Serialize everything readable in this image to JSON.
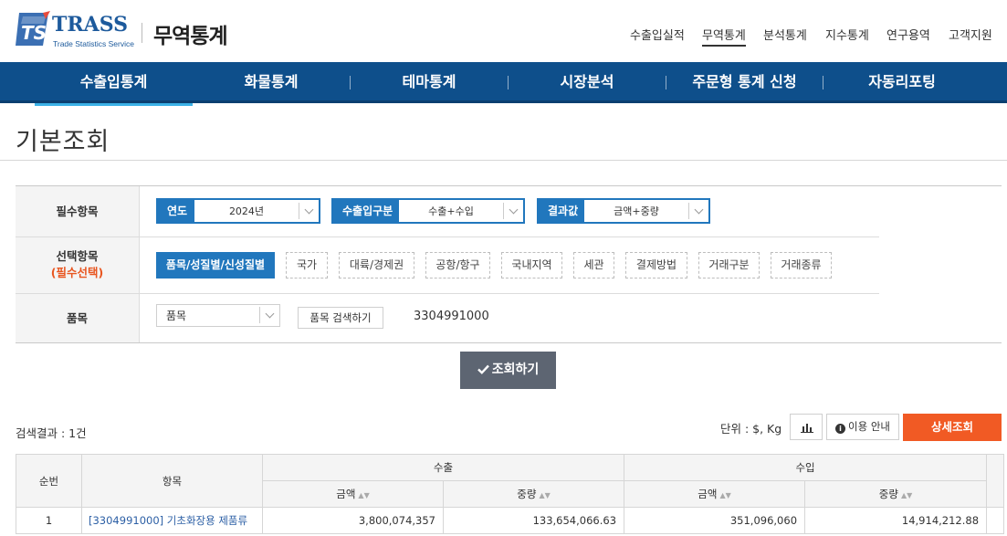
{
  "brand": {
    "logo_mark": "TS",
    "logo_word": "TRASS",
    "logo_sub": "Trade Statistics Service",
    "site_title": "무역통계"
  },
  "util_menu": [
    "수출입실적",
    "무역통계",
    "분석통계",
    "지수통계",
    "연구용역",
    "고객지원"
  ],
  "gnb": [
    "수출입통계",
    "화물통계",
    "테마통계",
    "시장분석",
    "주문형 통계 신청",
    "자동리포팅"
  ],
  "page_title": "기본조회",
  "filters": {
    "required_label": "필수항목",
    "year": {
      "label": "연도",
      "value": "2024년"
    },
    "trade_type": {
      "label": "수출입구분",
      "value": "수출+수입"
    },
    "result": {
      "label": "결과값",
      "value": "금액+중량"
    },
    "optional_label": "선택항목",
    "optional_note": "(필수선택)",
    "chips": [
      "품목/성질별/신성질별",
      "국가",
      "대륙/경제권",
      "공항/항구",
      "국내지역",
      "세관",
      "결제방법",
      "거래구분",
      "거래종류"
    ],
    "item_label": "품목",
    "item_select": "품목",
    "item_search_button": "품목 검색하기",
    "item_code": "3304991000"
  },
  "query_button": "조회하기",
  "results": {
    "count": "검색결과 : 1건",
    "unit": "단위 : $, Kg",
    "guide_button": "이용 안내",
    "detail_button": "상세조회",
    "headers": {
      "seq": "순번",
      "item": "항목",
      "export": "수출",
      "import": "수입",
      "amount": "금액",
      "weight": "중량"
    },
    "rows": [
      {
        "seq": "1",
        "item": "[3304991000] 기초화장용 제품류",
        "export_amount": "3,800,074,357",
        "export_weight": "133,654,066.63",
        "import_amount": "351,096,060",
        "import_weight": "14,914,212.88"
      }
    ]
  },
  "colors": {
    "nav_bg": "#0e4f8b",
    "accent_blue": "#2177bd",
    "orange": "#f15a24",
    "query_btn": "#5d6572"
  }
}
